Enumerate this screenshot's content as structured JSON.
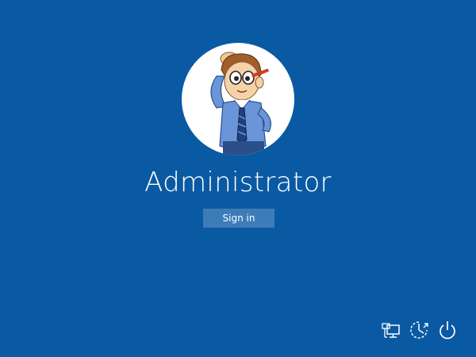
{
  "user": {
    "name": "Administrator",
    "avatar_icon": "cartoon-man-scratching-head-avatar"
  },
  "signin": {
    "label": "Sign in"
  },
  "tray": {
    "icons": [
      "network-icon",
      "ease-of-access-icon",
      "power-icon"
    ]
  },
  "colors": {
    "background": "#0a5aa3",
    "button": "#3d7cb8",
    "text": "#ffffff"
  }
}
